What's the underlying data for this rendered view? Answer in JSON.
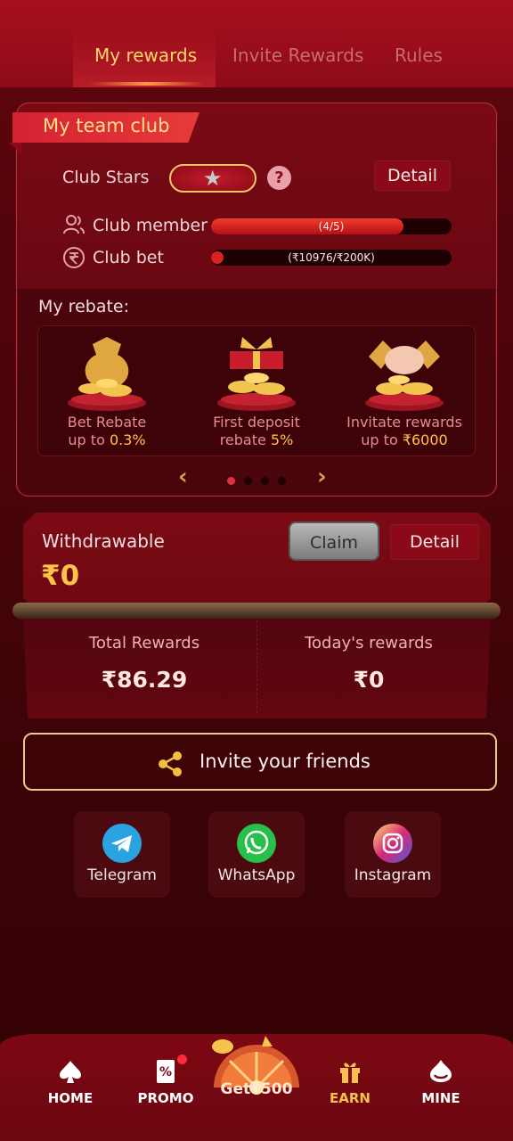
{
  "tabs": [
    {
      "label": "My rewards",
      "active": true
    },
    {
      "label": "Invite Rewards",
      "active": false
    },
    {
      "label": "Rules",
      "active": false
    }
  ],
  "club": {
    "title": "My team club",
    "stars_label": "Club Stars",
    "detail_label": "Detail",
    "member_label": "Club member",
    "member_progress_text": "(4/5)",
    "member_progress": 0.8,
    "bet_label": "Club bet",
    "bet_progress_text": "(₹10976/₹200K)",
    "bet_progress": 0.055
  },
  "rebate": {
    "title": "My rebate:",
    "items": [
      {
        "line1": "Bet Rebate",
        "line2_prefix": "up to ",
        "line2_value": "0.3%"
      },
      {
        "line1": "First deposit",
        "line2_prefix": "rebate ",
        "line2_value": "5%"
      },
      {
        "line1": "Invitate rewards",
        "line2_prefix": "up to ",
        "line2_value": "₹6000"
      }
    ],
    "page_count": 4,
    "active_page": 1
  },
  "withdraw": {
    "label": "Withdrawable",
    "value": "₹0",
    "claim_label": "Claim",
    "detail_label": "Detail"
  },
  "totals": {
    "total_label": "Total Rewards",
    "total_value": "₹86.29",
    "today_label": "Today's rewards",
    "today_value": "₹0"
  },
  "invite": {
    "label": "Invite your friends"
  },
  "share": [
    {
      "label": "Telegram",
      "icon": "telegram-icon",
      "color": "#2aa3e0"
    },
    {
      "label": "WhatsApp",
      "icon": "whatsapp-icon",
      "color": "#27c04a"
    },
    {
      "label": "Instagram",
      "icon": "instagram-icon",
      "color": "#d62f8a"
    }
  ],
  "nav": {
    "home": "HOME",
    "promo": "PROMO",
    "get": "Get₹500",
    "earn": "EARN",
    "mine": "MINE"
  },
  "colors": {
    "accent_gold": "#ffd76a",
    "brand_red": "#8e0b18",
    "value_gold": "#ffc24a"
  }
}
